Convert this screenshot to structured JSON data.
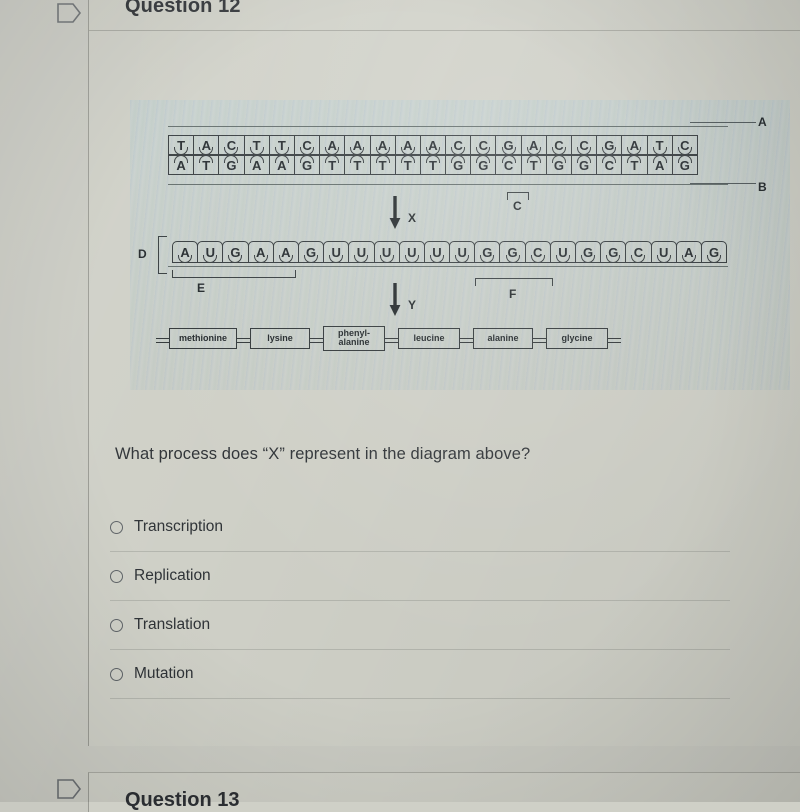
{
  "page": {
    "background_color": "#cbccc4",
    "card_color": "#cfd0c7"
  },
  "question": {
    "header_title": "Question 12",
    "flag_icon": "bookmark-flag-icon",
    "prompt": "What process does “X” represent in the diagram above?",
    "options": [
      {
        "label": "Transcription",
        "selected": false
      },
      {
        "label": "Replication",
        "selected": false
      },
      {
        "label": "Translation",
        "selected": false
      },
      {
        "label": "Mutation",
        "selected": false
      }
    ]
  },
  "next_question": {
    "header_title": "Question 13",
    "flag_icon": "bookmark-flag-icon"
  },
  "diagram": {
    "dna_top_strand": [
      "T",
      "A",
      "C",
      "T",
      "T",
      "C",
      "A",
      "A",
      "A",
      "A",
      "A",
      "C",
      "C",
      "G",
      "A",
      "C",
      "C",
      "G",
      "A",
      "T",
      "C"
    ],
    "dna_bottom_strand": [
      "A",
      "T",
      "G",
      "A",
      "A",
      "G",
      "T",
      "T",
      "T",
      "T",
      "T",
      "G",
      "G",
      "C",
      "T",
      "G",
      "G",
      "C",
      "T",
      "A",
      "G"
    ],
    "mrna_strand": [
      "A",
      "U",
      "G",
      "A",
      "A",
      "G",
      "U",
      "U",
      "U",
      "U",
      "U",
      "U",
      "G",
      "G",
      "C",
      "U",
      "G",
      "G",
      "C",
      "U",
      "A",
      "G"
    ],
    "amino_acids": [
      "methionine",
      "lysine",
      "phenyl-\nalanine",
      "leucine",
      "alanine",
      "glycine"
    ],
    "labels": {
      "a": "A",
      "b": "B",
      "c": "C",
      "d": "D",
      "e": "E",
      "f": "F",
      "x": "X",
      "y": "Y"
    }
  }
}
